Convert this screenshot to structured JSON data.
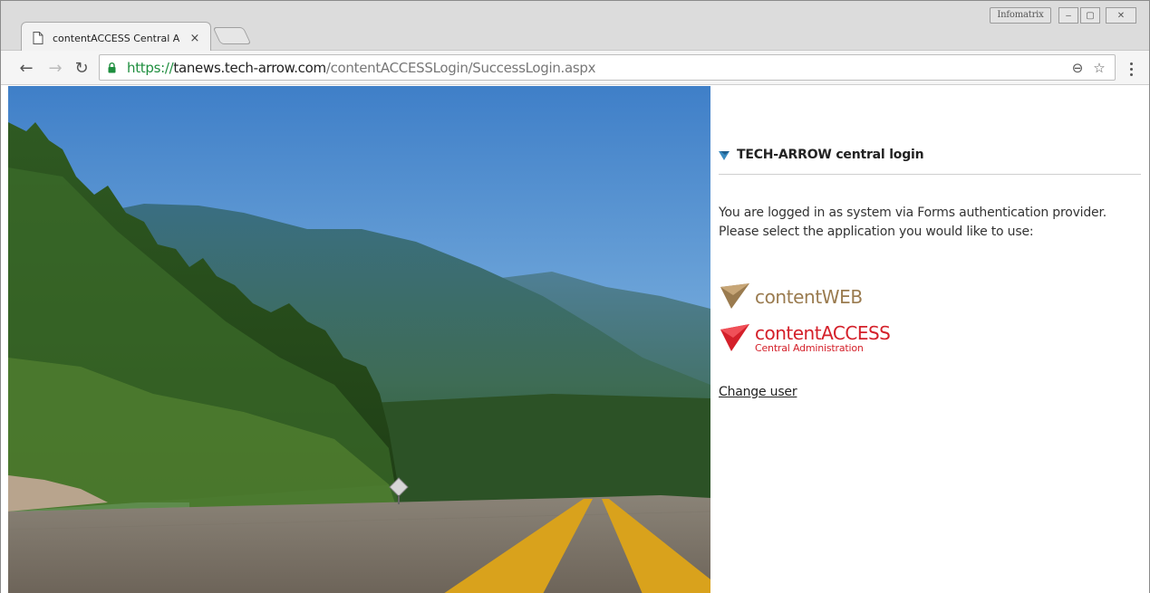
{
  "browser": {
    "tab": {
      "title": "contentACCESS Central Ad",
      "close_glyph": "×",
      "favicon": "page-icon"
    },
    "profile_label": "Infomatrix",
    "window_controls": {
      "minimize": "–",
      "maximize": "▢",
      "close": "✕"
    },
    "nav": {
      "back": "←",
      "forward": "→",
      "reload": "↻"
    },
    "address": {
      "scheme": "https://",
      "host": "tanews.tech-arrow.com",
      "path": "/contentACCESSLogin/SuccessLogin.aspx"
    },
    "zoom_icon": "⊖",
    "star_icon": "☆"
  },
  "page": {
    "header": {
      "title": "TECH-ARROW central login",
      "icon": "arrow-logo-icon"
    },
    "message_line1": "You are logged in as system via Forms authentication provider.",
    "message_line2": "Please select the application you would like to use:",
    "apps": [
      {
        "label": "contentWEB",
        "color": "#9a7b4f"
      },
      {
        "label": "contentACCESS",
        "subtitle": "Central Administration",
        "color": "#d4202a"
      }
    ],
    "change_user": "Change user"
  },
  "colors": {
    "accent_web": "#9a7b4f",
    "accent_access": "#d4202a",
    "secure_green": "#1e8e3e"
  }
}
